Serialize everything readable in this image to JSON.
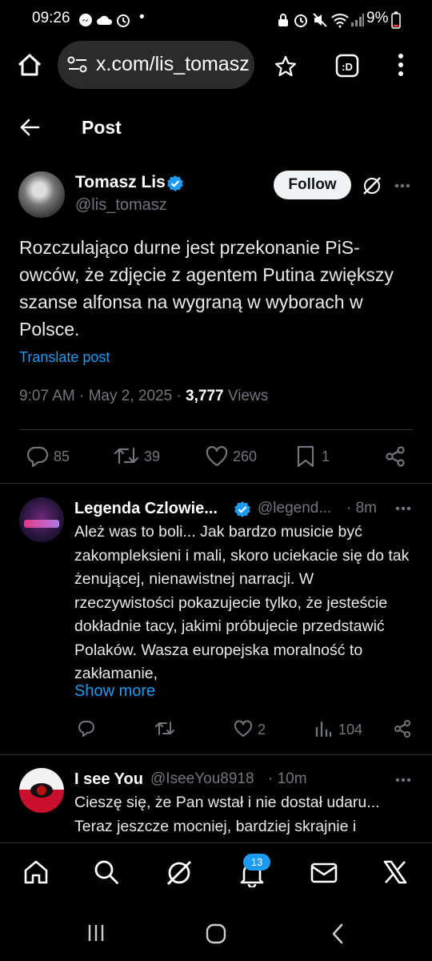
{
  "status_bar": {
    "time": "09:26",
    "dot": "•",
    "battery": "9%"
  },
  "browser": {
    "url": "x.com/lis_tomasz/"
  },
  "header": {
    "title": "Post"
  },
  "post": {
    "author_name": "Tomasz Lis",
    "author_handle": "@lis_tomasz",
    "follow_label": "Follow",
    "text": "Rozczulająco durne jest przekonanie PiS-owców, że zdjęcie z agentem Putina zwiększy szanse alfonsa na wygraną w wyborach w Polsce.",
    "translate_label": "Translate post",
    "timestamp": "9:07 AM · May 2, 2025 · ",
    "views_count": "3,777",
    "views_label": " Views",
    "stats": {
      "replies": "85",
      "reposts": "39",
      "likes": "260",
      "bookmarks": "1"
    }
  },
  "replies": [
    {
      "name": "Legenda Czlowie...",
      "handle": "@legend...",
      "time": "· 8m",
      "text": "Ależ was to boli... Jak bardzo musicie być zakompleksieni i mali, skoro uciekacie się do tak żenującej, nienawistnej narracji. W rzeczywistości pokazujecie tylko, że jesteście dokładnie tacy, jakimi próbujecie przedstawić Polaków. Wasza europejska moralność to zakłamanie,",
      "show_more": "Show more",
      "stats": {
        "likes": "2",
        "views": "104"
      }
    },
    {
      "name": "I see You",
      "handle": "@IseeYou8918",
      "time": "· 10m",
      "text": "Cieszę się, że Pan wstał i nie dostał udaru... Teraz jeszcze mocniej, bardziej skrajnie i"
    }
  ],
  "bottom_nav": {
    "notifications_badge": "13"
  },
  "colors": {
    "accent": "#1d9bf0",
    "background": "#000000",
    "muted": "#71767b"
  }
}
